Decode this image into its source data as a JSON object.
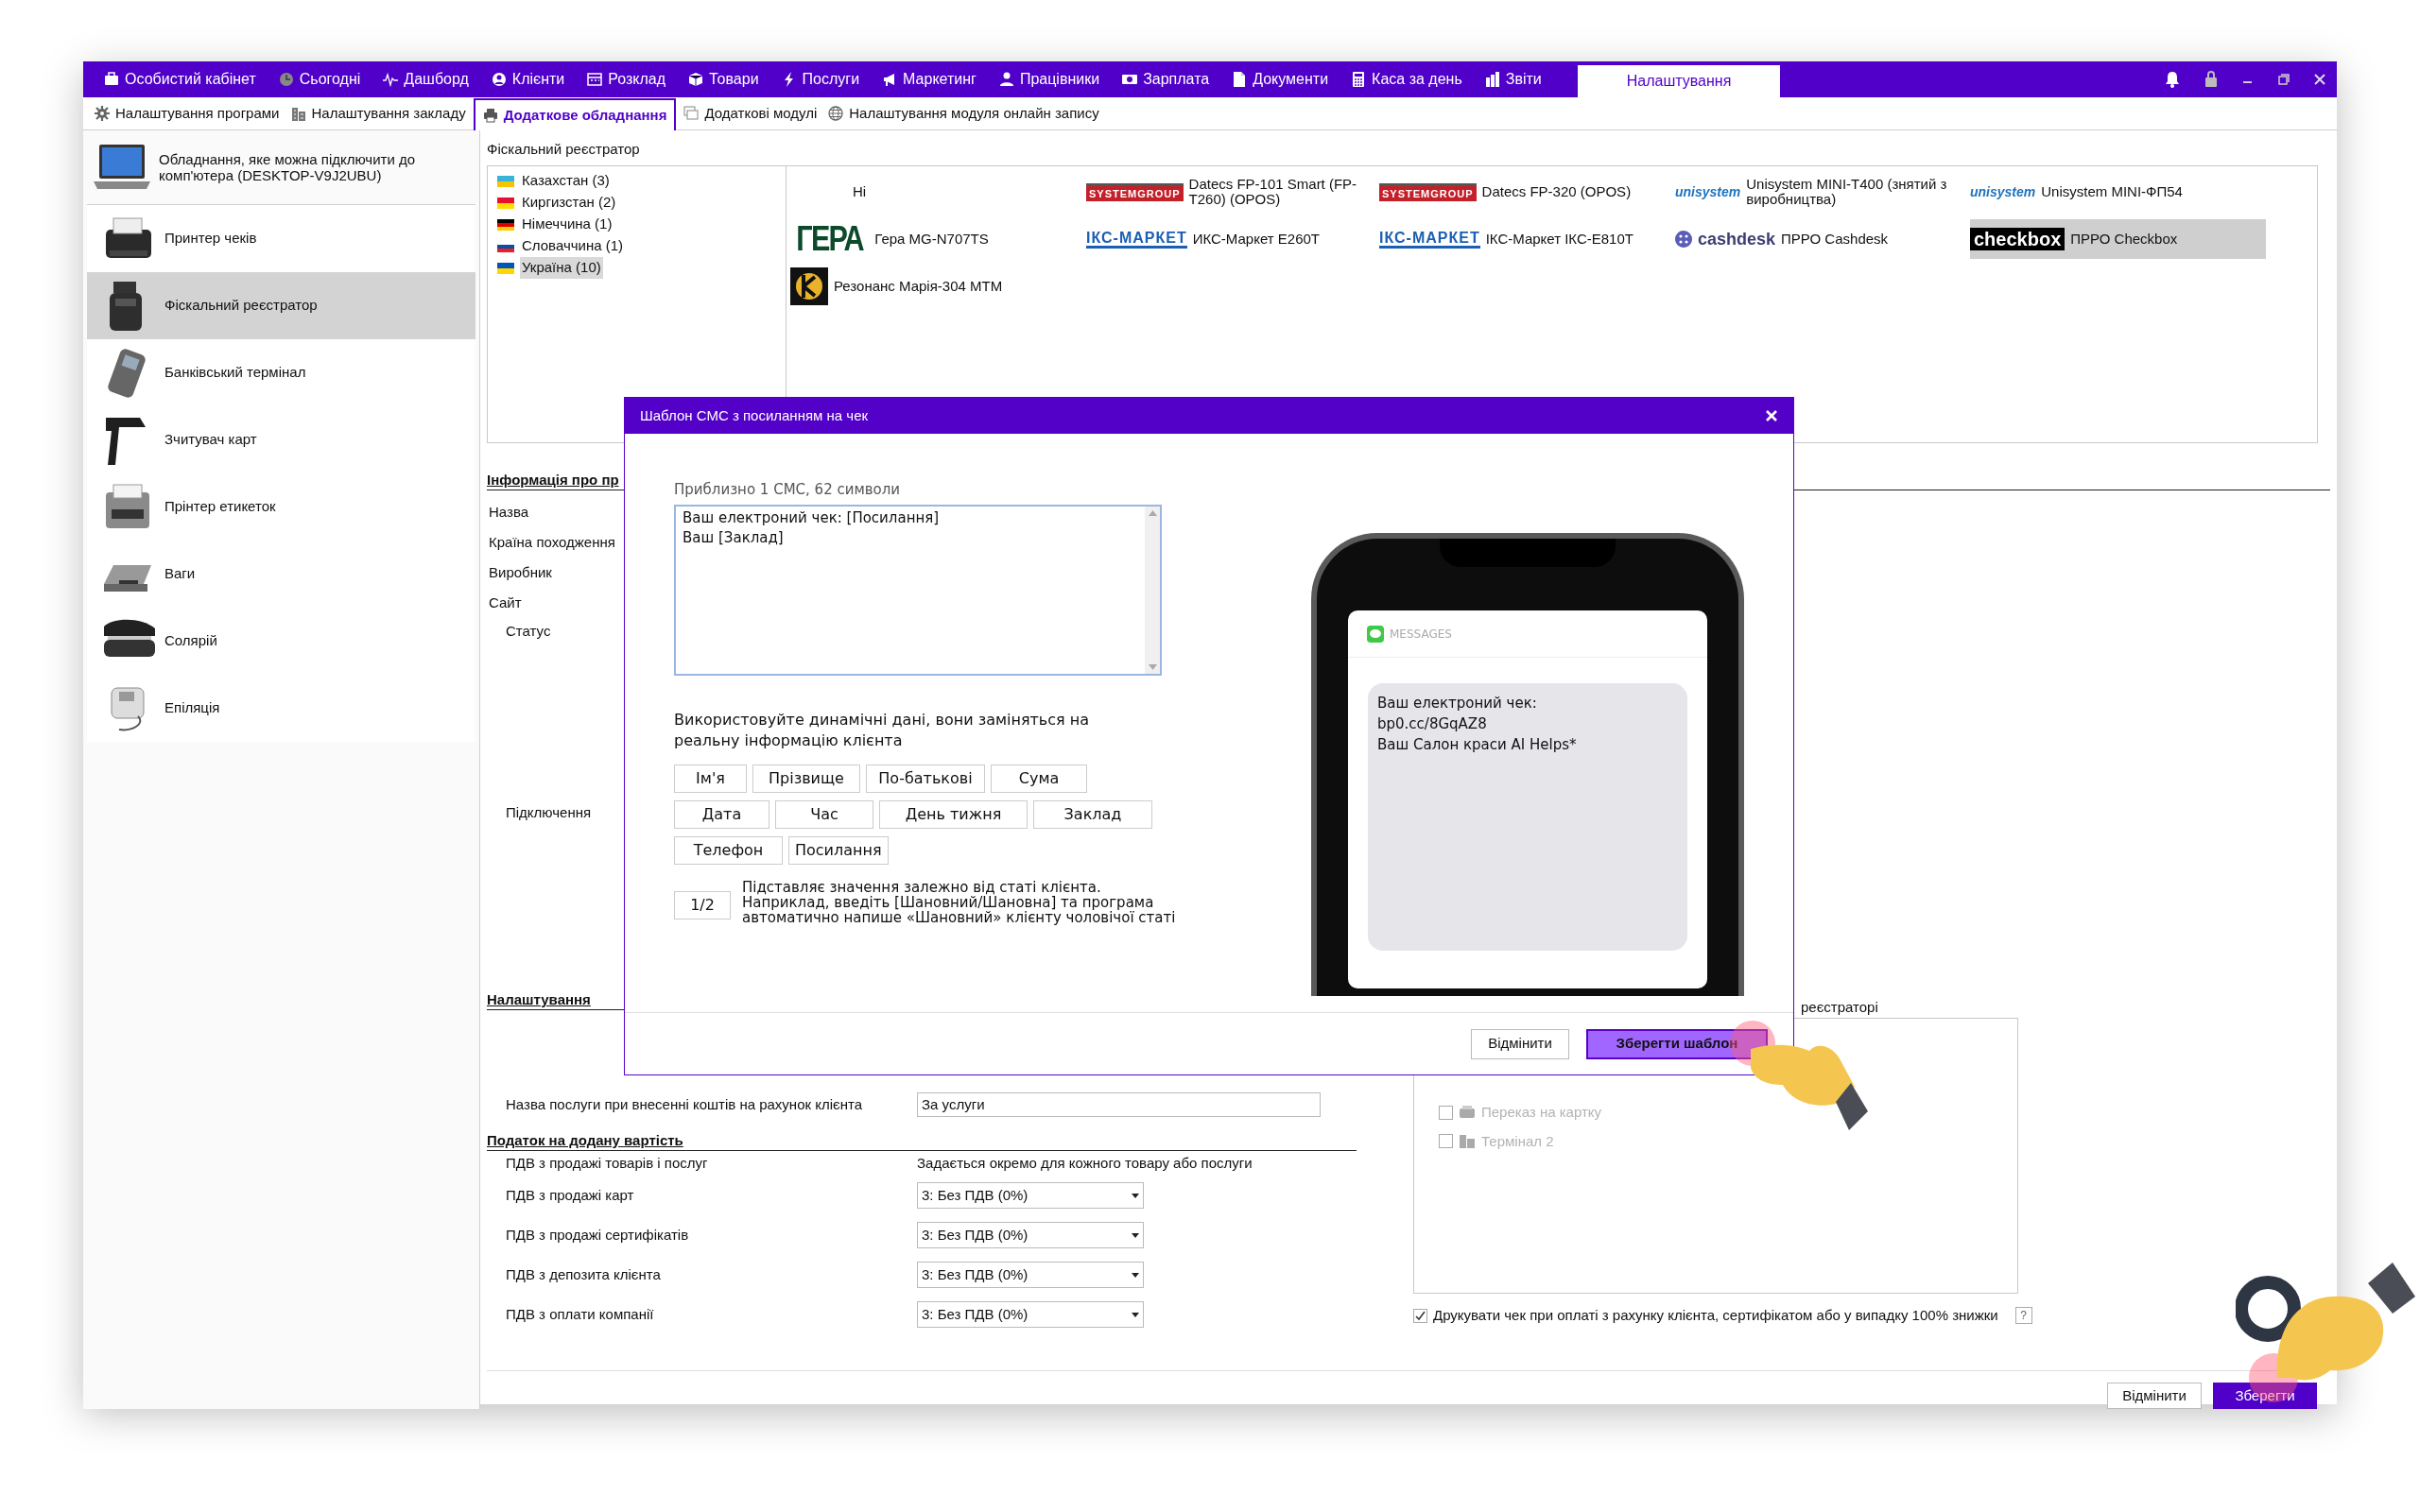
{
  "menu": [
    {
      "label": "Особистий кабінет",
      "selected": false
    },
    {
      "label": "Сьогодні",
      "selected": false
    },
    {
      "label": "Дашборд",
      "selected": false
    },
    {
      "label": "Клієнти",
      "selected": false
    },
    {
      "label": "Розклад",
      "selected": false
    },
    {
      "label": "Товари",
      "selected": false
    },
    {
      "label": "Послуги",
      "selected": false
    },
    {
      "label": "Маркетинг",
      "selected": false
    },
    {
      "label": "Працівники",
      "selected": false
    },
    {
      "label": "Зарплата",
      "selected": false
    },
    {
      "label": "Документи",
      "selected": false
    },
    {
      "label": "Каса за день",
      "selected": false
    },
    {
      "label": "Звіти",
      "selected": false
    },
    {
      "label": "Налаштування",
      "selected": true
    }
  ],
  "subtabs": [
    {
      "label": "Налаштування програми",
      "selected": false
    },
    {
      "label": "Налаштування закладу",
      "selected": false
    },
    {
      "label": "Додаткове обладнання",
      "selected": true
    },
    {
      "label": "Додаткові модулі",
      "selected": false
    },
    {
      "label": "Налаштування модуля онлайн запису",
      "selected": false
    }
  ],
  "sidebar": {
    "header": "Обладнання, яке можна підключити до комп'ютера (DESKTOP-V9J2UBU)",
    "items": [
      {
        "label": "Принтер чеків",
        "selected": false
      },
      {
        "label": "Фіскальний реєстратор",
        "selected": true
      },
      {
        "label": "Банківський термінал",
        "selected": false
      },
      {
        "label": "Зчитувач карт",
        "selected": false
      },
      {
        "label": "Прінтер етикеток",
        "selected": false
      },
      {
        "label": "Ваги",
        "selected": false
      },
      {
        "label": "Солярій",
        "selected": false
      },
      {
        "label": "Епіляція",
        "selected": false
      }
    ]
  },
  "fiscal": {
    "title": "Фіскальний реєстратор",
    "countries": [
      {
        "label": "Казахстан (3)",
        "selected": false
      },
      {
        "label": "Киргизстан (2)",
        "selected": false
      },
      {
        "label": "Німеччина (1)",
        "selected": false
      },
      {
        "label": "Словаччина (1)",
        "selected": false
      },
      {
        "label": "Україна (10)",
        "selected": true
      }
    ],
    "devices": [
      {
        "kind": "none",
        "name": "Ні",
        "selected": false
      },
      {
        "kind": "systemgroup",
        "logo": "SYSTEMGROUP",
        "name": "Datecs FP-101 Smart (FP-T260) (OPOS)",
        "selected": false
      },
      {
        "kind": "systemgroup",
        "logo": "SYSTEMGROUP",
        "name": "Datecs FP-320 (OPOS)",
        "selected": false
      },
      {
        "kind": "unisystem",
        "logo": "unisystem",
        "name": "Unisystem MINI-T400 (знятий з виробництва)",
        "selected": false
      },
      {
        "kind": "unisystem",
        "logo": "unisystem",
        "name": "Unisystem MINI-ФП54",
        "selected": false
      },
      {
        "kind": "gera",
        "logo": "ГЕРА",
        "name": "Гера MG-N707TS",
        "selected": false
      },
      {
        "kind": "iks",
        "logo": "ІКС-МАРКЕТ",
        "name": "ИКС-Маркет E260T",
        "selected": false
      },
      {
        "kind": "iks",
        "logo": "ІКС-МАРКЕТ",
        "name": "ІКС-Маркет ІКС-E810T",
        "selected": false
      },
      {
        "kind": "cashdesk",
        "logo": "cashdesk",
        "name": "ПРРО Cashdesk",
        "selected": false
      },
      {
        "kind": "checkbox",
        "logo": "checkbox",
        "name": "ПРРО Checkbox",
        "selected": true
      },
      {
        "kind": "resonans",
        "name": "Резонанс Марія-304 МТМ",
        "selected": false
      }
    ]
  },
  "info": {
    "heading": "Інформація про пр",
    "labels": [
      "Назва",
      "Країна походження",
      "Виробник",
      "Сайт"
    ],
    "status_label": "Статус",
    "connection_label": "Підключення"
  },
  "settings": {
    "heading": "Налаштування",
    "service_label": "Назва послуги при внесенні коштів на рахунок клієнта",
    "service_value": "За услуги"
  },
  "vat": {
    "heading": "Податок на додану вартість",
    "rows": [
      {
        "kind": "text",
        "label": "ПДВ з продажі товарів і послуг",
        "value": "Задається окремо для кожного товару або послуги"
      },
      {
        "kind": "select",
        "label": "ПДВ з продажі карт",
        "value": "3: Без ПДВ (0%)"
      },
      {
        "kind": "select",
        "label": "ПДВ з продажі сертифікатів",
        "value": "3: Без ПДВ (0%)"
      },
      {
        "kind": "select",
        "label": "ПДВ з депозита клієнта",
        "value": "3: Без ПДВ (0%)"
      },
      {
        "kind": "select",
        "label": "ПДВ з оплати компанії",
        "value": "3: Без ПДВ (0%)"
      }
    ]
  },
  "payments": {
    "label": "реєстраторі",
    "items": [
      {
        "label": "Переказ на картку",
        "checked": false,
        "disabled": true
      },
      {
        "label": "Термінал 2",
        "checked": false,
        "disabled": true
      }
    ],
    "print_check": {
      "label": "Друкувати чек при оплаті з рахунку клієнта, сертифікатом або у випадку 100% знижки",
      "checked": true
    },
    "help": "?"
  },
  "footer_buttons": [
    "Відмінити",
    "Зберегти"
  ],
  "dialog": {
    "title": "Шаблон СМС з посиланням на чек",
    "counter": "Приблизно 1 СМС, 62 символи",
    "template": "Ваш електроний чек: [Посилання]\nВаш [Заклад]",
    "hint": "Використовуйте динамічні дані, вони заміняться на реальну інформацію клієнта",
    "chips": [
      [
        "Ім'я",
        "Прізвище",
        "По-батькові",
        "Сума"
      ],
      [
        "Дата",
        "Час",
        "День тижня",
        "Заклад"
      ],
      [
        "Телефон",
        "Посилання"
      ]
    ],
    "gender_chip": "1/2",
    "gender_hint": "Підставляє значення залежно від статі клієнта. Наприклад, введіть [Шановний/Шановна] та програма автоматично напише «Шановний» клієнту чоловічої статі",
    "preview": {
      "app": "MESSAGES",
      "message": "Ваш електроний чек:\nbp0.cc/8GqAZ8\nВаш Салон краси AI Helps*"
    },
    "buttons": [
      "Відмінити",
      "Зберегти шаблон"
    ]
  }
}
